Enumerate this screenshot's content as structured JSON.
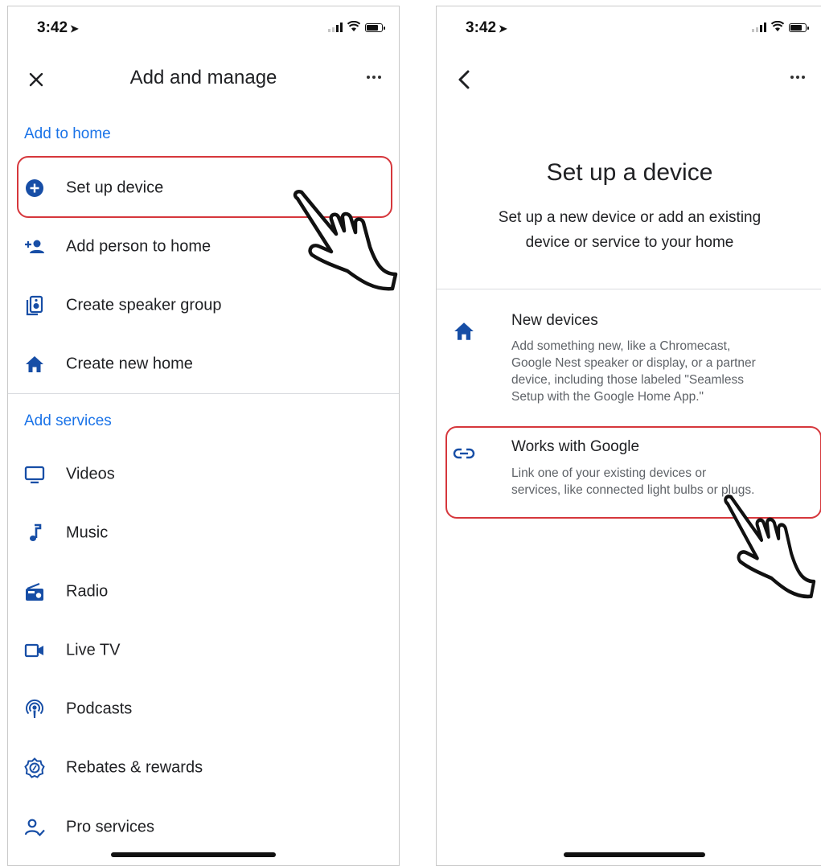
{
  "left_screen": {
    "status": {
      "time": "3:42",
      "location_arrow": "➤"
    },
    "header": {
      "close_icon": "close-icon",
      "title": "Add and manage",
      "more_icon": "more-horiz-icon"
    },
    "add_to_home": {
      "heading": "Add to home",
      "items": [
        {
          "label": "Set up device",
          "icon": "add-circle-icon"
        },
        {
          "label": "Add person to home",
          "icon": "person-add-icon"
        },
        {
          "label": "Create speaker group",
          "icon": "speaker-group-icon"
        },
        {
          "label": "Create new home",
          "icon": "home-icon"
        }
      ]
    },
    "add_services": {
      "heading": "Add services",
      "items": [
        {
          "label": "Videos",
          "icon": "tv-icon"
        },
        {
          "label": "Music",
          "icon": "music-note-icon"
        },
        {
          "label": "Radio",
          "icon": "radio-icon"
        },
        {
          "label": "Live TV",
          "icon": "videocam-icon"
        },
        {
          "label": "Podcasts",
          "icon": "podcasts-icon"
        },
        {
          "label": "Rebates & rewards",
          "icon": "rebates-badge-icon"
        },
        {
          "label": "Pro services",
          "icon": "person-check-icon"
        }
      ]
    }
  },
  "right_screen": {
    "status": {
      "time": "3:42",
      "location_arrow": "➤"
    },
    "header": {
      "back_icon": "back-chevron-icon",
      "more_icon": "more-horiz-icon"
    },
    "title": "Set up a device",
    "subtitle_line1": "Set up a new device or add an existing",
    "subtitle_line2": "device or service to your home",
    "options": [
      {
        "title": "New devices",
        "icon": "home-icon",
        "desc_lines": [
          "Add something new, like a Chromecast,",
          "Google Nest speaker or display, or a partner",
          "device, including those labeled \"Seamless",
          "Setup with the Google Home App.\""
        ]
      },
      {
        "title": "Works with Google",
        "icon": "link-icon",
        "desc_lines": [
          "Link one of your existing devices or",
          "services, like connected light bulbs or plugs."
        ]
      }
    ]
  },
  "colors": {
    "accent_blue": "#1a73e8",
    "icon_blue": "#174ea6",
    "highlight_red": "#d6373c",
    "divider": "#dadce0"
  }
}
